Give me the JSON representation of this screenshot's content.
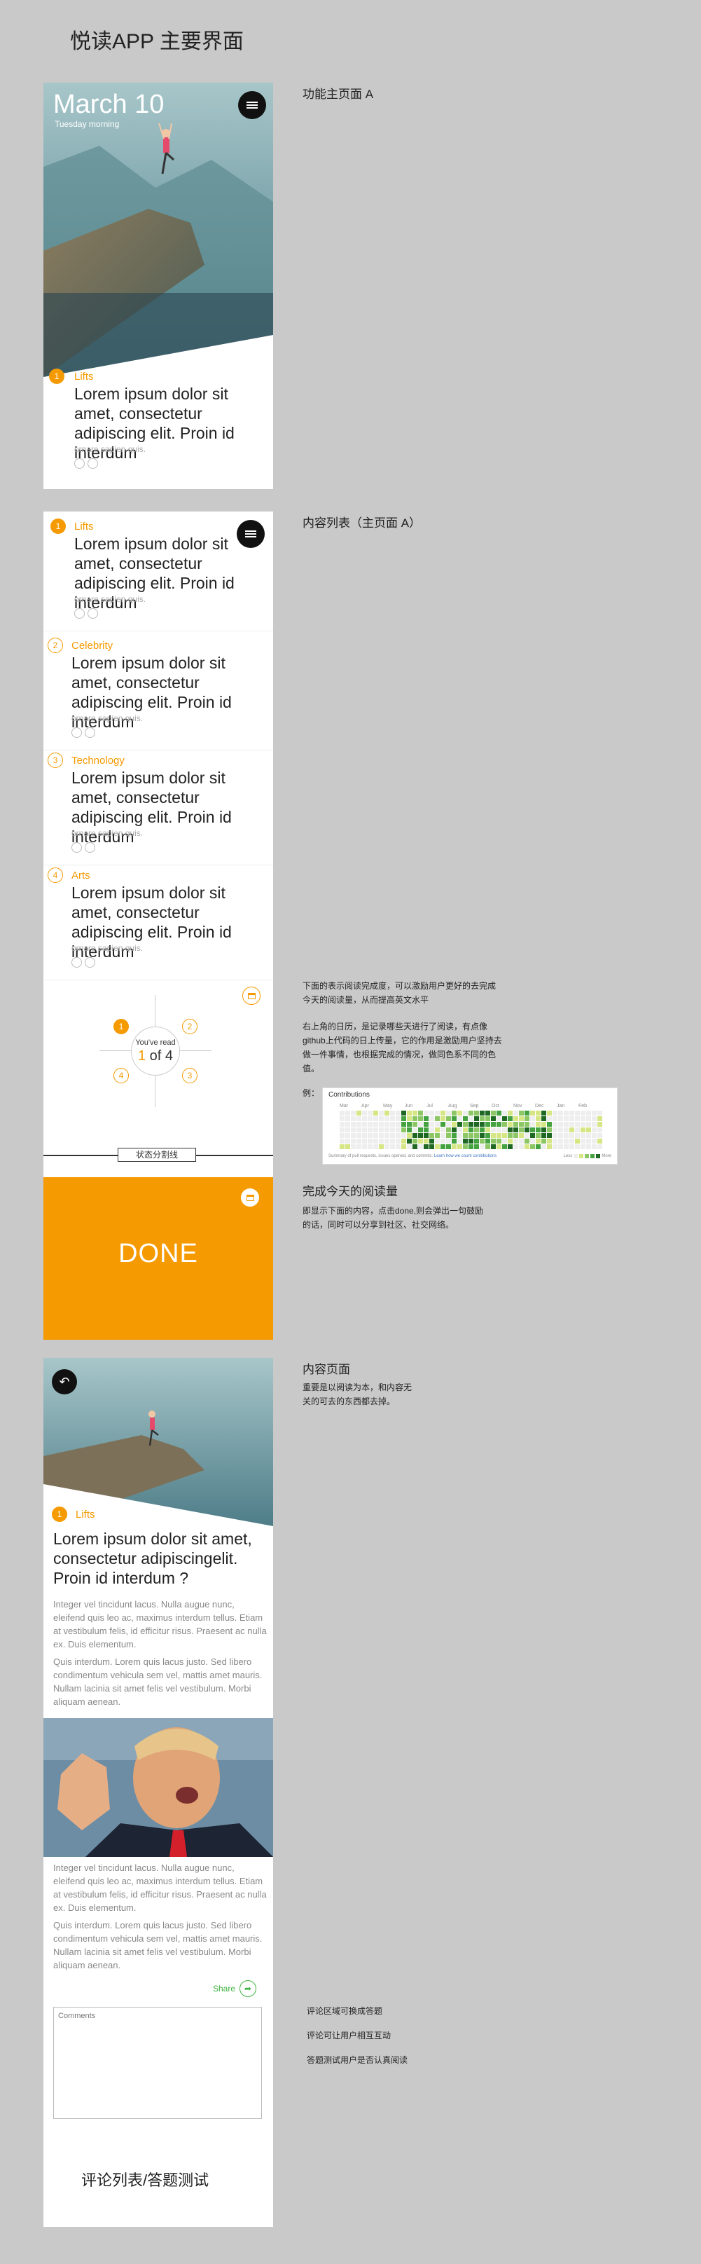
{
  "page_title": "悦读APP 主要界面",
  "screen1": {
    "right_label": "功能主页面 A",
    "date": "March 10",
    "day": "Tuesday morning",
    "item": {
      "number": "1",
      "category": "Lifts",
      "headline": "Lorem ipsum dolor sit amet, consectetur adipiscing elit. Proin id interdum",
      "sub": "ornare sapien quis."
    }
  },
  "screen2": {
    "right_label": "内容列表（主页面 A）",
    "items": [
      {
        "number": "1",
        "category": "Lifts",
        "headline": "Lorem ipsum dolor sit amet, consectetur adipiscing elit. Proin id interdum",
        "sub": "ornare sapien quis."
      },
      {
        "number": "2",
        "category": "Celebrity",
        "headline": "Lorem ipsum dolor sit amet, consectetur adipiscing elit. Proin id interdum",
        "sub": "ornare sapien quis."
      },
      {
        "number": "3",
        "category": "Technology",
        "headline": "Lorem ipsum dolor sit amet, consectetur adipiscing elit. Proin id interdum",
        "sub": "ornare sapien quis."
      },
      {
        "number": "4",
        "category": "Arts",
        "headline": "Lorem ipsum dolor sit amet, consectetur adipiscing elit. Proin id interdum",
        "sub": "ornare sapien quis."
      }
    ],
    "progress": {
      "label": "You've read",
      "current": "1",
      "of_text": "of 4",
      "nodes": [
        "1",
        "2",
        "3",
        "4"
      ]
    },
    "divider_label": "状态分割线",
    "done_label": "DONE",
    "progress_desc": "下面的表示阅读完成度，可以激励用户更好的去完成今天的阅读量，从而提高英文水平",
    "calendar_desc": "右上角的日历，是记录哪些天进行了阅读，有点像github上代码的日上传量，它的作用是激励用户坚持去做一件事情，也根据完成的情况，做同色系不同的色值。",
    "example_label": "例：",
    "contributions": {
      "title": "Contributions",
      "months": [
        "Mar",
        "Apr",
        "May",
        "Jun",
        "Jul",
        "Aug",
        "Sep",
        "Oct",
        "Nov",
        "Dec",
        "Jan",
        "Feb"
      ],
      "footer_left": "Summary of pull requests, issues opened, and commits.",
      "footer_link": "Learn how we count contributions",
      "less": "Less",
      "more": "More"
    },
    "done_title": "完成今天的阅读量",
    "done_desc": "即显示下面的内容，点击done,则会弹出一句鼓励的话，同时可以分享到社区、社交网络。"
  },
  "screen3": {
    "right_label": "内容页面",
    "right_desc": "重要是以阅读为本，和内容无关的可去的东西都去掉。",
    "number": "1",
    "category": "Lifts",
    "headline": "Lorem ipsum dolor sit amet, consectetur adipiscingelit. Proin id interdum ?",
    "paragraphs": [
      "Integer vel tincidunt lacus. Nulla augue nunc, eleifend quis leo ac, maximus interdum tellus. Etiam at vestibulum felis, id efficitur risus. Praesent ac nulla ex. Duis elementum.",
      "Quis interdum. Lorem quis lacus justo. Sed libero condimentum vehicula sem vel, mattis amet mauris. Nullam lacinia sit amet felis vel vestibulum. Morbi aliquam aenean.",
      "Integer vel tincidunt lacus. Nulla augue nunc, eleifend quis leo ac, maximus interdum tellus. Etiam at vestibulum felis, id efficitur risus. Praesent ac nulla ex. Duis elementum.",
      "Quis interdum. Lorem quis lacus justo. Sed libero condimentum vehicula sem vel, mattis amet mauris. Nullam lacinia sit amet felis vel vestibulum. Morbi aliquam aenean."
    ],
    "share_label": "Share",
    "comments_placeholder": "Comments",
    "footer_title": "评论列表/答题测试",
    "notes": [
      "评论区域可换成答题",
      "评论可让用户相互互动",
      "答题测试用户是否认真阅读"
    ]
  },
  "colors": {
    "accent": "#f59a00",
    "share": "#3fb33f",
    "background": "#c9c9c9"
  }
}
